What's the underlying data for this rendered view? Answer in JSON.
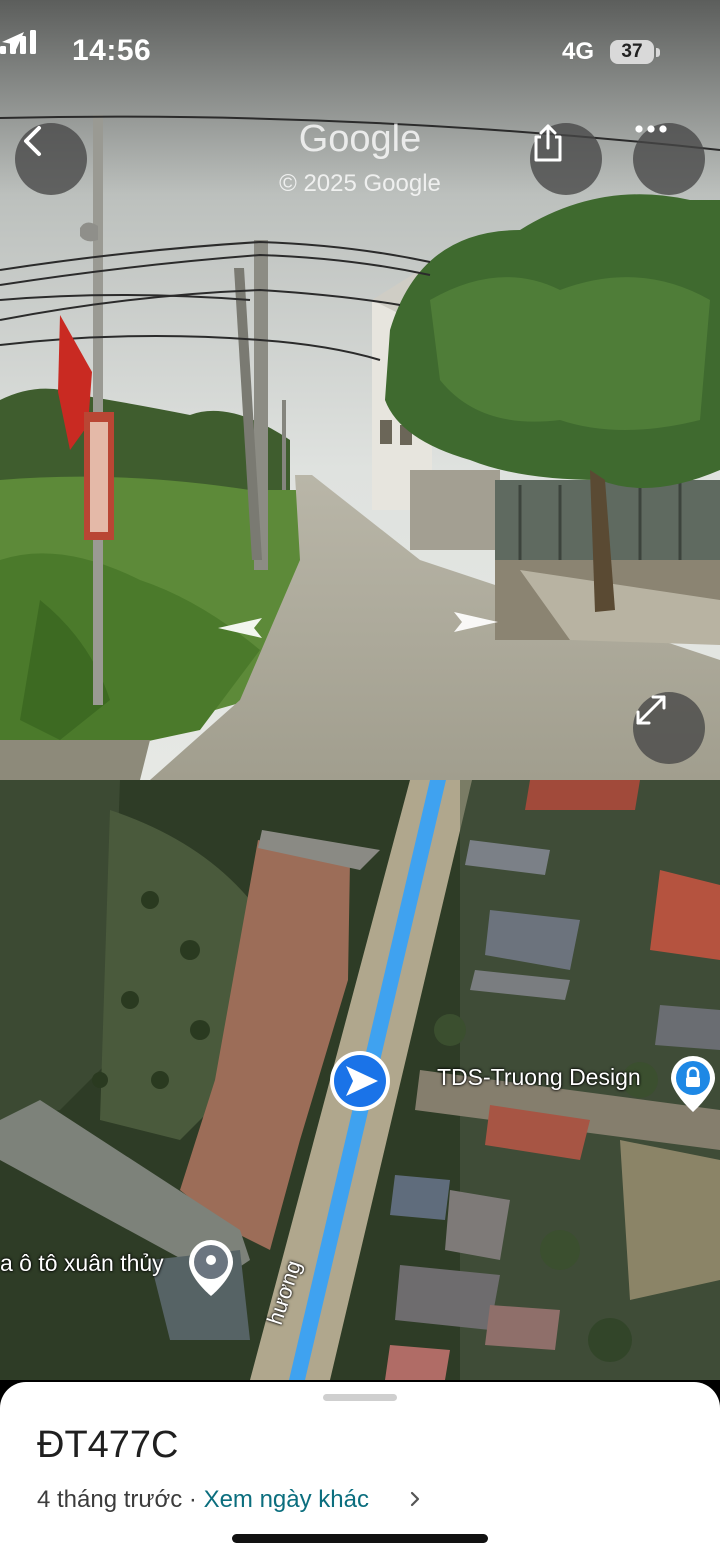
{
  "status_bar": {
    "time": "14:56",
    "network": "4G",
    "battery": "37"
  },
  "street_view": {
    "brand": "Google",
    "copyright": "© 2025 Google",
    "buttons": {
      "back": "back-arrow-icon",
      "share": "share-icon",
      "more": "more-icon",
      "expand": "expand-icon"
    }
  },
  "map": {
    "road_label": "hương",
    "places": [
      {
        "name": "TDS-Truong Design",
        "icon": "lock-pin-icon"
      },
      {
        "name": "a ô tô xuân thủy",
        "icon": "place-pin-icon"
      }
    ]
  },
  "sheet": {
    "title": "ĐT477C",
    "time_ago": "4 tháng trước",
    "separator": "·",
    "other_dates_link": "Xem ngày khác"
  },
  "colors": {
    "route": "#3fa2f0",
    "location_marker": "#1a73e8",
    "link": "#0b6e7e"
  }
}
